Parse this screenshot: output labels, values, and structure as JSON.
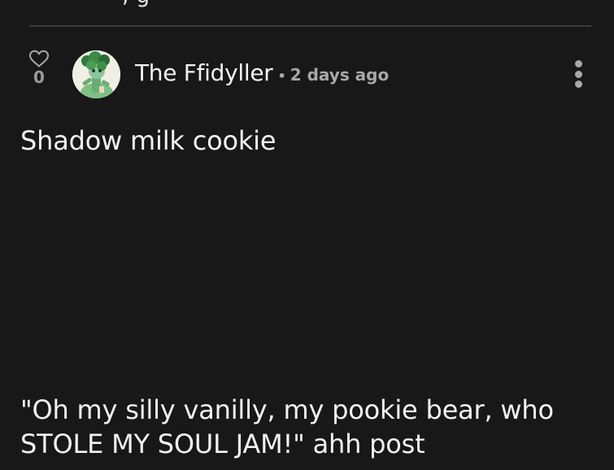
{
  "previous_post": {
    "cut_off_text": "          ,                   g"
  },
  "post": {
    "vote_count": "0",
    "author": "The Ffidyller",
    "separator": "•",
    "timestamp": "2 days ago",
    "body_title": "Shadow milk cookie",
    "body_lines": [
      "\"Oh my silly vanilly, my pookie bear, who",
      "STOLE MY SOUL JAM!\" ahh post"
    ]
  },
  "icons": {
    "like": "heart-outline-icon",
    "more": "vertical-ellipsis-icon",
    "avatar": "user-avatar-image"
  },
  "colors": {
    "background": "#181818",
    "text": "#f2f2f2",
    "muted": "#a8a8a8",
    "divider": "#3c3c3c"
  }
}
